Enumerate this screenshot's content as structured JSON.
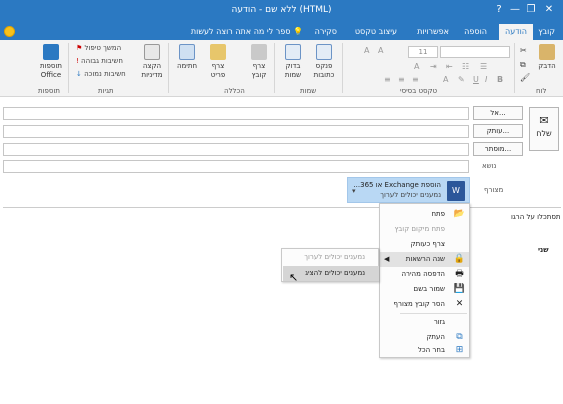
{
  "window": {
    "title": "ללא שם  -  הודעה (HTML)",
    "controls": [
      "?",
      "—",
      "❐",
      "✕"
    ]
  },
  "tabs": [
    {
      "label": "קובץ",
      "active": false
    },
    {
      "label": "הודעה",
      "active": true
    },
    {
      "label": "הוספה",
      "active": false
    },
    {
      "label": "אפשרויות",
      "active": false
    },
    {
      "label": "עיצוב טקסט",
      "active": false
    },
    {
      "label": "סקירה",
      "active": false
    }
  ],
  "tell_me": "ספר לי מה אתה רוצה לעשות",
  "ribbon": {
    "clipboard": {
      "paste": "הדבק",
      "group": "לוח"
    },
    "basic_text": {
      "group": "טקסט בסיסי",
      "font_size": "11"
    },
    "names": {
      "address_book": "פנקס כתובות",
      "check_names": "בדוק שמות",
      "group": "שמות"
    },
    "include": {
      "attach_file": "צרף קובץ",
      "attach_item": "צרף פריט",
      "signature": "חתימה",
      "group": "הכללה"
    },
    "tags": {
      "assign_policy": "הקצה מדיניות",
      "follow_up": "המשך טיפול",
      "high_importance": "חשיבות גבוהה",
      "low_importance": "חשיבות נמוכה",
      "group": "תגיות"
    },
    "addins": {
      "office_addins": "תוספות Office",
      "group": "תוספות"
    }
  },
  "compose": {
    "send": "שלח",
    "to": "אל...",
    "cc": "עותק...",
    "bcc": "מוסתר...",
    "subject_label": "נושא",
    "attached_label": "מצורף"
  },
  "attachment": {
    "line1": "הוספת Exchange או 365...",
    "line2": "נמענים יכולים לערוך",
    "icon_letter": "W"
  },
  "body": {
    "line1": "תסתכלו על הרגו",
    "line2": "שני"
  },
  "context_menu": [
    {
      "label": "פתח",
      "icon": "open-folder-icon",
      "glyph": "📂",
      "disabled": false
    },
    {
      "label": "פתח מיקום קובץ",
      "icon": "folder-location-icon",
      "glyph": "",
      "disabled": true
    },
    {
      "label": "צרף כעותק",
      "icon": "attach-copy-icon",
      "glyph": "",
      "disabled": false
    },
    {
      "label": "שנה הרשאות",
      "icon": "permissions-icon",
      "glyph": "🔒",
      "disabled": false,
      "highlighted": true,
      "submenu": true
    },
    {
      "label": "הדפסה מהירה",
      "icon": "printer-icon",
      "glyph": "🖶",
      "disabled": false
    },
    {
      "label": "שמור בשם",
      "icon": "save-icon",
      "glyph": "💾",
      "disabled": false
    },
    {
      "label": "הסר קובץ מצורף",
      "icon": "remove-x-icon",
      "glyph": "✕",
      "disabled": false
    },
    {
      "label": "גזור",
      "icon": "cut-icon",
      "glyph": "",
      "disabled": false
    },
    {
      "label": "העתק",
      "icon": "copy-icon",
      "glyph": "⧉",
      "disabled": false
    },
    {
      "label": "בחר הכל",
      "icon": "select-all-icon",
      "glyph": "⊞",
      "disabled": false
    }
  ],
  "submenu": [
    {
      "label": "נמענים יכולים לערוך",
      "disabled": true
    },
    {
      "label": "נמענים יכולים להציג",
      "disabled": false,
      "highlighted": true
    }
  ]
}
